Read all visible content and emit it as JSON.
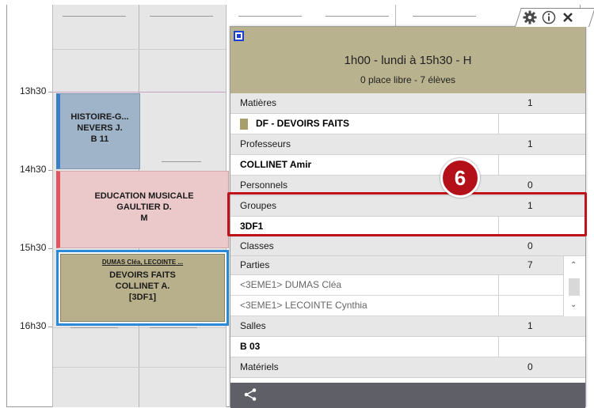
{
  "colors": {
    "course_history": "#9fb4c8",
    "course_music": "#ebc9cb",
    "course_homework": "#b8b08a",
    "popup_header": "#b9b28e",
    "highlight": "#c0121a",
    "toolbar": "#5f6067"
  },
  "times": [
    "13h30",
    "14h30",
    "15h30",
    "16h30"
  ],
  "courses": {
    "history": {
      "line1": "HISTOIRE-G...",
      "line2": "NEVERS J.",
      "line3": "B 11"
    },
    "music": {
      "line1": "EDUCATION MUSICALE",
      "line2": "GAULTIER D.",
      "line3": "M"
    },
    "homework": {
      "students": "DUMAS Cléa, LECOINTE ...",
      "line1": "DEVOIRS FAITS",
      "line2": "COLLINET A.",
      "line3": "[3DF1]"
    }
  },
  "popup": {
    "icons": [
      "gear-icon",
      "info-icon",
      "close-icon"
    ],
    "title": "1h00 - lundi à 15h30 - H",
    "subtitle": "0 place libre - 7 élèves",
    "sections": {
      "matieres": {
        "label": "Matières",
        "count": "1",
        "value": "DF - DEVOIRS FAITS"
      },
      "professeurs": {
        "label": "Professeurs",
        "count": "1",
        "value": "COLLINET Amir"
      },
      "personnels": {
        "label": "Personnels",
        "count": "0"
      },
      "groupes": {
        "label": "Groupes",
        "count": "1",
        "value": "3DF1"
      },
      "classes": {
        "label": "Classes",
        "count": "0"
      },
      "parties": {
        "label": "Parties",
        "count": "7",
        "items": [
          "<3EME1> DUMAS Cléa",
          "<3EME1> LECOINTE Cynthia"
        ]
      },
      "salles": {
        "label": "Salles",
        "count": "1",
        "value": "B 03"
      },
      "materiels": {
        "label": "Matériels",
        "count": "0"
      }
    },
    "toolbar_icon": "share-icon"
  },
  "callout": {
    "number": "6"
  }
}
